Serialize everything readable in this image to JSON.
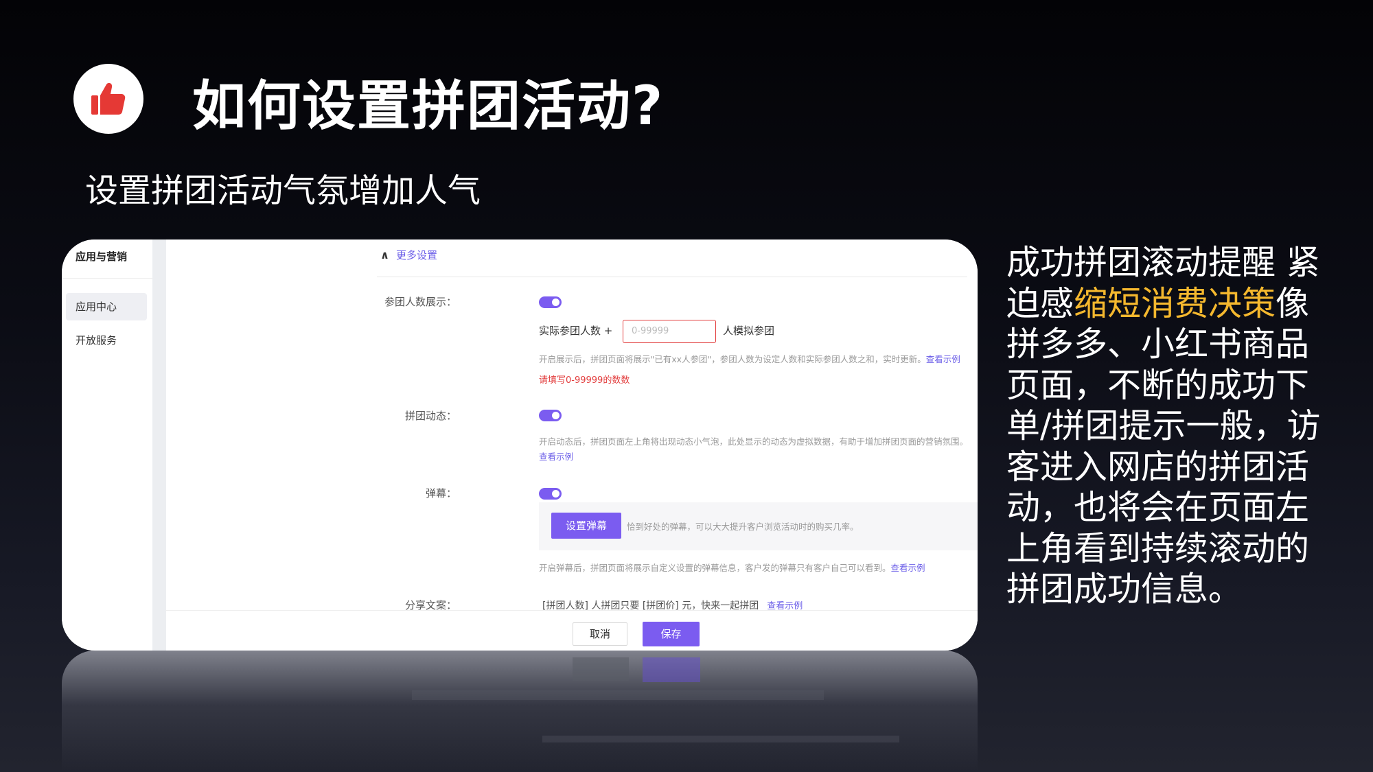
{
  "header": {
    "title": "如何设置拼团活动?",
    "subtitle": "设置拼团活动气氛增加人气",
    "logo_icon": "thumbs-up-icon",
    "accent_color": "#e53935"
  },
  "sidebar": {
    "title": "应用与营销",
    "items": [
      {
        "label": "应用中心",
        "active": true
      },
      {
        "label": "开放服务",
        "active": false
      }
    ]
  },
  "settings": {
    "more_label": "更多设置",
    "participants": {
      "label": "参团人数展示：",
      "enabled": true,
      "actual_label": "实际参团人数 +",
      "input_placeholder": "0-99999",
      "suffix": "人模拟参团",
      "help": "开启展示后，拼团页面将展示\"已有xx人参团\"，参团人数为设定人数和实际参团人数之和，实时更新。",
      "help_link": "查看示例",
      "error": "请填写0-99999的数数"
    },
    "dynamics": {
      "label": "拼团动态：",
      "enabled": true,
      "help": "开启动态后，拼团页面左上角将出现动态小气泡，此处显示的动态为虚拟数据，有助于增加拼团页面的营销氛围。",
      "help_link": "查看示例"
    },
    "danmu": {
      "label": "弹幕：",
      "enabled": true,
      "button": "设置弹幕",
      "tip": "恰到好处的弹幕，可以大大提升客户浏览活动时的购买几率。",
      "help": "开启弹幕后，拼团页面将展示自定义设置的弹幕信息，客户发的弹幕只有客户自己可以看到。",
      "help_link": "查看示例"
    },
    "share": {
      "label": "分享文案：",
      "text": "[拼团人数] 人拼团只要 [拼团价] 元，快来一起拼团",
      "link": "查看示例"
    }
  },
  "footer": {
    "cancel": "取消",
    "save": "保存"
  },
  "description": {
    "part1": "成功拼团滚动提醒 紧迫感",
    "highlight": "缩短消费决策",
    "part2": "像拼多多、小红书商品页面，不断的成功下单/拼团提示一般，访客进入网店的拼团活动，也将会在页面左上角看到持续滚动的拼团成功信息。",
    "highlight_color": "#f5b82e"
  }
}
